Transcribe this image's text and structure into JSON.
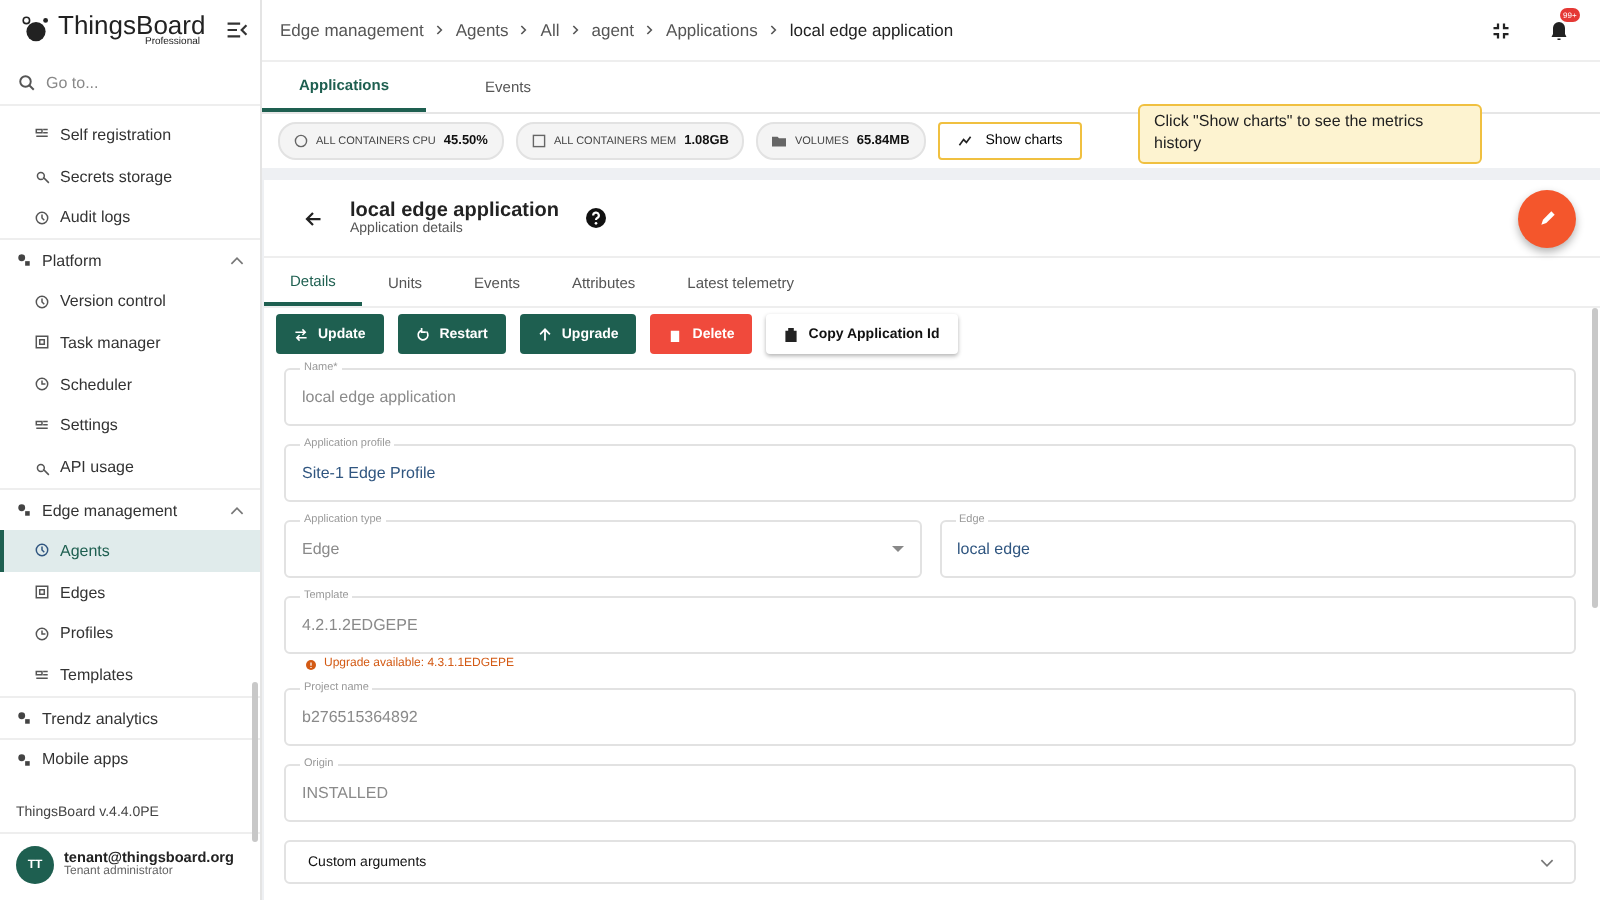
{
  "logo": {
    "name": "ThingsBoard",
    "edition": "Professional"
  },
  "search": {
    "placeholder": "Go to..."
  },
  "sidebar": {
    "items": [
      {
        "label": "Self registration",
        "kind": "sub",
        "selected": false
      },
      {
        "label": "Secrets storage",
        "kind": "sub",
        "selected": false
      },
      {
        "label": "Audit logs",
        "kind": "sub",
        "selected": false
      },
      {
        "label": "Platform",
        "kind": "section",
        "expanded": true,
        "children": [
          {
            "label": "Version control",
            "selected": false
          },
          {
            "label": "Task manager",
            "selected": false
          },
          {
            "label": "Scheduler",
            "selected": false
          },
          {
            "label": "Settings",
            "selected": false
          },
          {
            "label": "API usage",
            "selected": false
          }
        ]
      },
      {
        "label": "Edge management",
        "kind": "section",
        "expanded": true,
        "children": [
          {
            "label": "Agents",
            "selected": true
          },
          {
            "label": "Edges",
            "selected": false
          },
          {
            "label": "Profiles",
            "selected": false
          },
          {
            "label": "Templates",
            "selected": false
          }
        ]
      },
      {
        "label": "Trendz analytics",
        "kind": "section",
        "selected": false
      },
      {
        "label": "Mobile apps",
        "kind": "section",
        "selected": false
      }
    ]
  },
  "version": "ThingsBoard v.4.4.0PE",
  "user": {
    "initials": "TT",
    "email": "tenant@thingsboard.org",
    "role": "Tenant administrator"
  },
  "breadcrumb": [
    "Edge management",
    "Agents",
    "All",
    "agent",
    "Applications",
    "local edge application"
  ],
  "notifications": {
    "badge": "99+"
  },
  "top_tabs": [
    {
      "label": "Applications",
      "selected": true
    },
    {
      "label": "Events",
      "selected": false
    }
  ],
  "metrics": [
    {
      "label": "ALL CONTAINERS CPU",
      "value": "45.50%"
    },
    {
      "label": "ALL CONTAINERS MEM",
      "value": "1.08GB"
    },
    {
      "label": "VOLUMES",
      "value": "65.84MB"
    }
  ],
  "show_charts": {
    "label": "Show charts",
    "highlighted": true
  },
  "hint": "Click \"Show charts\" to see the metrics history",
  "details": {
    "title": "local edge application",
    "subtitle": "Application details",
    "tabs": [
      {
        "label": "Details",
        "selected": true
      },
      {
        "label": "Units",
        "selected": false
      },
      {
        "label": "Events",
        "selected": false
      },
      {
        "label": "Attributes",
        "selected": false
      },
      {
        "label": "Latest telemetry",
        "selected": false
      }
    ],
    "buttons": [
      {
        "label": "Update",
        "kind": "primary"
      },
      {
        "label": "Restart",
        "kind": "primary"
      },
      {
        "label": "Upgrade",
        "kind": "primary"
      },
      {
        "label": "Delete",
        "kind": "warn"
      },
      {
        "label": "Copy Application Id",
        "kind": "stroked"
      }
    ],
    "fields": [
      [
        {
          "label": "Name*",
          "value": "local edge application",
          "kind": "text",
          "disabled": true
        }
      ],
      [
        {
          "label": "Application profile",
          "value": "Site-1 Edge Profile",
          "kind": "link",
          "disabled": false
        }
      ],
      [
        {
          "label": "Application type",
          "value": "Edge",
          "kind": "select",
          "disabled": true
        },
        {
          "label": "Edge",
          "value": "local edge",
          "kind": "link",
          "disabled": false
        }
      ],
      [
        {
          "label": "Template",
          "value": "4.2.1.2EDGEPE",
          "kind": "text",
          "disabled": true,
          "warning": "Upgrade available: 4.3.1.1EDGEPE"
        }
      ],
      [
        {
          "label": "Project name",
          "value": "b276515364892",
          "kind": "text",
          "disabled": true
        }
      ],
      [
        {
          "label": "Origin",
          "value": "INSTALLED",
          "kind": "text",
          "disabled": true
        }
      ]
    ],
    "panel": {
      "title": "Custom arguments",
      "expanded": false
    }
  }
}
